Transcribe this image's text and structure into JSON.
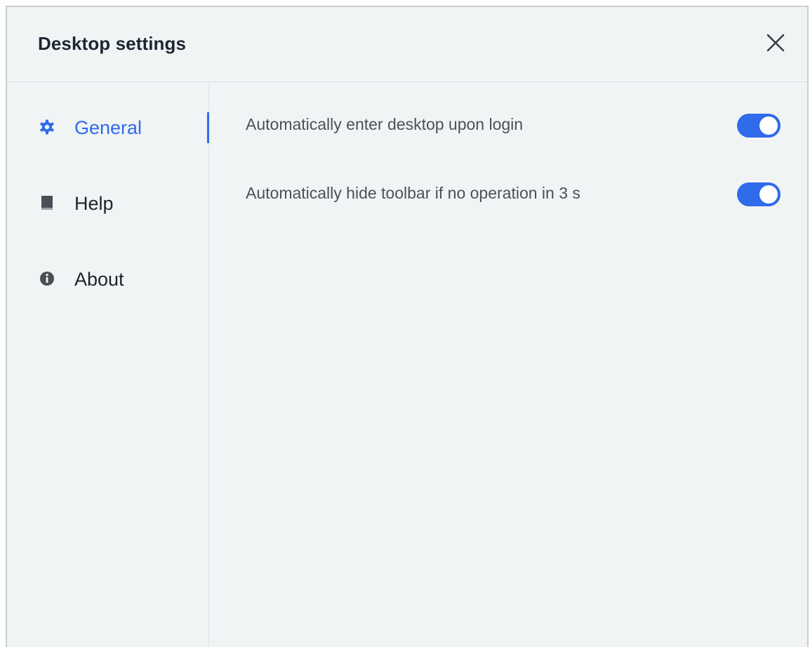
{
  "dialog": {
    "title": "Desktop settings",
    "close_icon": "close-icon"
  },
  "sidebar": {
    "items": [
      {
        "label": "General",
        "icon": "gear-icon",
        "active": true
      },
      {
        "label": "Help",
        "icon": "book-icon",
        "active": false
      },
      {
        "label": "About",
        "icon": "info-icon",
        "active": false
      }
    ]
  },
  "settings": [
    {
      "label": "Automatically enter desktop upon login",
      "enabled": true
    },
    {
      "label": "Automatically hide toolbar if no operation in 3 s",
      "enabled": true
    }
  ],
  "colors": {
    "accent": "#2f6bea",
    "background": "#f0f4f5",
    "title_text": "#1d2733",
    "body_text": "#4b5157"
  }
}
